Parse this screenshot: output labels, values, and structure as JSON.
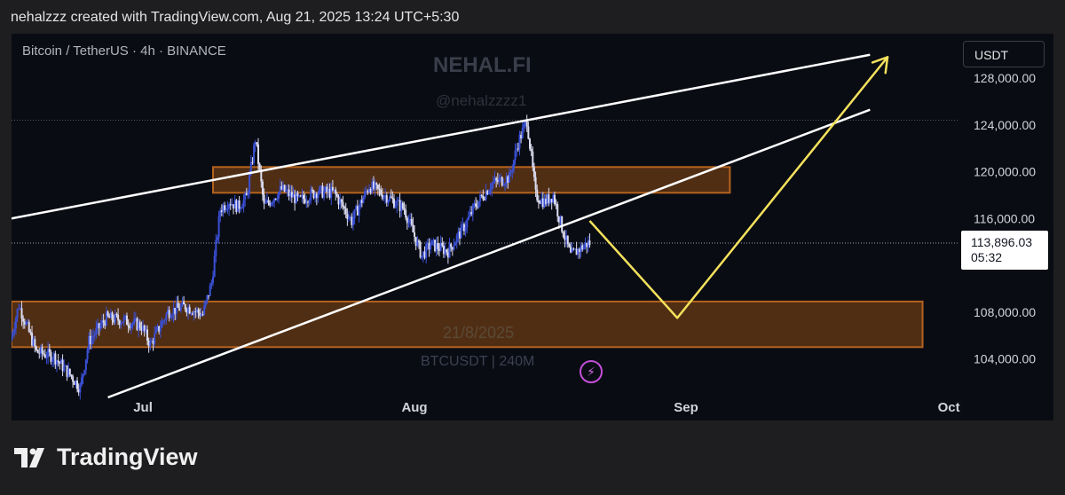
{
  "header": {
    "text": "nehalzzz created with TradingView.com, Aug 21, 2025 13:24 UTC+5:30"
  },
  "chart": {
    "symbol": "Bitcoin / TetherUS · 4h · BINANCE",
    "currency": "USDT"
  },
  "watermarks": {
    "title": "NEHAL.FI",
    "handle": "@nehalzzzz1",
    "date": "21/8/2025",
    "pair": "BTCUSDT | 240M"
  },
  "price_tag": {
    "price": "113,896.03",
    "countdown": "05:32"
  },
  "footer": {
    "brand": "TradingView"
  },
  "colors": {
    "background": "#0a0c14",
    "candle_up": "#3a50d6",
    "candle_down": "#dcdcf0",
    "zone": "#8a4a14",
    "trendline": "#ffffff",
    "projection": "#f4e25c"
  },
  "chart_data": {
    "type": "candlestick",
    "title": "",
    "x_ticks": [
      "Jul",
      "Aug",
      "Sep",
      "Oct"
    ],
    "y_ticks": [
      {
        "value": 104000,
        "label": "104,000.00"
      },
      {
        "value": 108000,
        "label": "108,000.00"
      },
      {
        "value": 116000,
        "label": "116,000.00"
      },
      {
        "value": 120000,
        "label": "120,000.00"
      },
      {
        "value": 124000,
        "label": "124,000.00"
      },
      {
        "value": 128000,
        "label": "128,000.00"
      }
    ],
    "ylim": [
      100700,
      131800
    ],
    "xlim": [
      "2025-06-16",
      "2025-10-02"
    ],
    "current_price": 113896.03,
    "price_path": [
      [
        "2025-06-16",
        105500
      ],
      [
        "2025-06-17",
        108600
      ],
      [
        "2025-06-19",
        104600
      ],
      [
        "2025-06-21",
        104200
      ],
      [
        "2025-06-23",
        102500
      ],
      [
        "2025-06-24",
        101500
      ],
      [
        "2025-06-25",
        105500
      ],
      [
        "2025-06-27",
        107500
      ],
      [
        "2025-06-29",
        107300
      ],
      [
        "2025-07-01",
        106800
      ],
      [
        "2025-07-02",
        105200
      ],
      [
        "2025-07-04",
        108000
      ],
      [
        "2025-07-06",
        108500
      ],
      [
        "2025-07-08",
        107800
      ],
      [
        "2025-07-09",
        110500
      ],
      [
        "2025-07-10",
        116800
      ],
      [
        "2025-07-11",
        117500
      ],
      [
        "2025-07-12",
        117000
      ],
      [
        "2025-07-13",
        117800
      ],
      [
        "2025-07-14",
        122800
      ],
      [
        "2025-07-15",
        117000
      ],
      [
        "2025-07-17",
        118500
      ],
      [
        "2025-07-19",
        117500
      ],
      [
        "2025-07-21",
        118300
      ],
      [
        "2025-07-23",
        118200
      ],
      [
        "2025-07-25",
        115800
      ],
      [
        "2025-07-27",
        118800
      ],
      [
        "2025-07-29",
        117900
      ],
      [
        "2025-07-31",
        116800
      ],
      [
        "2025-08-02",
        112800
      ],
      [
        "2025-08-03",
        113800
      ],
      [
        "2025-08-05",
        113200
      ],
      [
        "2025-08-07",
        115500
      ],
      [
        "2025-08-08",
        117000
      ],
      [
        "2025-08-10",
        119000
      ],
      [
        "2025-08-12",
        119500
      ],
      [
        "2025-08-13",
        122500
      ],
      [
        "2025-08-14",
        124400
      ],
      [
        "2025-08-15",
        118000
      ],
      [
        "2025-08-16",
        117400
      ],
      [
        "2025-08-17",
        118000
      ],
      [
        "2025-08-18",
        115200
      ],
      [
        "2025-08-19",
        112800
      ],
      [
        "2025-08-20",
        113400
      ],
      [
        "2025-08-21",
        113900
      ]
    ],
    "zones": [
      {
        "x0": "2025-07-09",
        "x1": "2025-09-06",
        "y0": 118200,
        "y1": 120400
      },
      {
        "x0": "2025-06-16",
        "x1": "2025-09-28",
        "y0": 105000,
        "y1": 108900
      }
    ],
    "trendlines": [
      {
        "x0": "2025-06-16",
        "y0": 116000,
        "x1": "2025-09-22",
        "y1": 130000
      },
      {
        "x0": "2025-06-27",
        "y0": 100700,
        "x1": "2025-09-22",
        "y1": 125300
      }
    ],
    "projection": [
      [
        "2025-08-21",
        115800
      ],
      [
        "2025-08-31",
        107500
      ],
      [
        "2025-09-24",
        129800
      ]
    ]
  }
}
